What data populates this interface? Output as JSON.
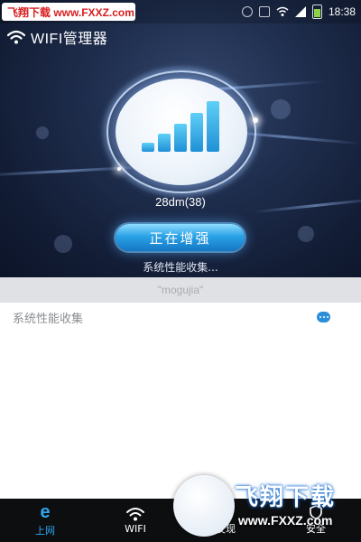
{
  "status_bar": {
    "watermark_text": "飞翔下载 www.FXXZ.com",
    "time": "18:38"
  },
  "header": {
    "title": "WIFI管理器",
    "icon": "wifi-icon"
  },
  "signal_panel": {
    "signal_text": "28dm(38)",
    "bars_filled": 5,
    "boost_button_label": "正在增强",
    "status_text": "系统性能收集..."
  },
  "network_strip": {
    "ssid": "\"mogujia\""
  },
  "list": {
    "item_label": "系统性能收集",
    "more_icon": "more-dots-icon"
  },
  "bottom_nav": {
    "items": [
      {
        "label": "上网",
        "icon": "e-browser-icon",
        "active": true
      },
      {
        "label": "WIFI",
        "icon": "wifi-icon",
        "active": false
      },
      {
        "label": "发现",
        "icon": "discover-icon",
        "active": false
      },
      {
        "label": "安全",
        "icon": "shield-icon",
        "active": false
      }
    ]
  },
  "watermark": {
    "title": "飞翔下载",
    "url": "www.FXXZ.com"
  },
  "colors": {
    "accent": "#2ea6ef",
    "hero_background": "#1f2e4e",
    "nav_background": "#0d0e10",
    "watermark_red": "#d81e1e"
  }
}
